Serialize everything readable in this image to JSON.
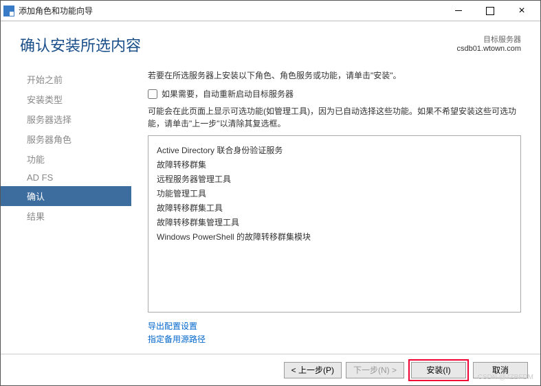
{
  "window": {
    "title": "添加角色和功能向导"
  },
  "header": {
    "title": "确认安装所选内容",
    "server_label": "目标服务器",
    "server_name": "csdb01.wtown.com"
  },
  "sidebar": {
    "items": [
      {
        "label": "开始之前",
        "active": false
      },
      {
        "label": "安装类型",
        "active": false
      },
      {
        "label": "服务器选择",
        "active": false
      },
      {
        "label": "服务器角色",
        "active": false
      },
      {
        "label": "功能",
        "active": false
      },
      {
        "label": "AD FS",
        "active": false
      },
      {
        "label": "确认",
        "active": true
      },
      {
        "label": "结果",
        "active": false
      }
    ]
  },
  "main": {
    "intro": "若要在所选服务器上安装以下角色、角色服务或功能，请单击\"安装\"。",
    "checkbox_label": "如果需要，自动重新启动目标服务器",
    "checkbox_checked": false,
    "info": "可能会在此页面上显示可选功能(如管理工具)，因为已自动选择这些功能。如果不希望安装这些可选功能，请单击\"上一步\"以清除其复选框。",
    "items": [
      {
        "text": "Active Directory 联合身份验证服务",
        "level": 1
      },
      {
        "text": "故障转移群集",
        "level": 1
      },
      {
        "text": "远程服务器管理工具",
        "level": 1
      },
      {
        "text": "功能管理工具",
        "level": 2
      },
      {
        "text": "故障转移群集工具",
        "level": 3
      },
      {
        "text": "故障转移群集管理工具",
        "level": 4
      },
      {
        "text": "Windows PowerShell 的故障转移群集模块",
        "level": 4
      }
    ],
    "link_export": "导出配置设置",
    "link_altpath": "指定备用源路径"
  },
  "footer": {
    "prev": "< 上一步(P)",
    "next": "下一步(N) >",
    "install": "安装(I)",
    "cancel": "取消"
  },
  "watermark": "CSDN @7ZBFDM"
}
